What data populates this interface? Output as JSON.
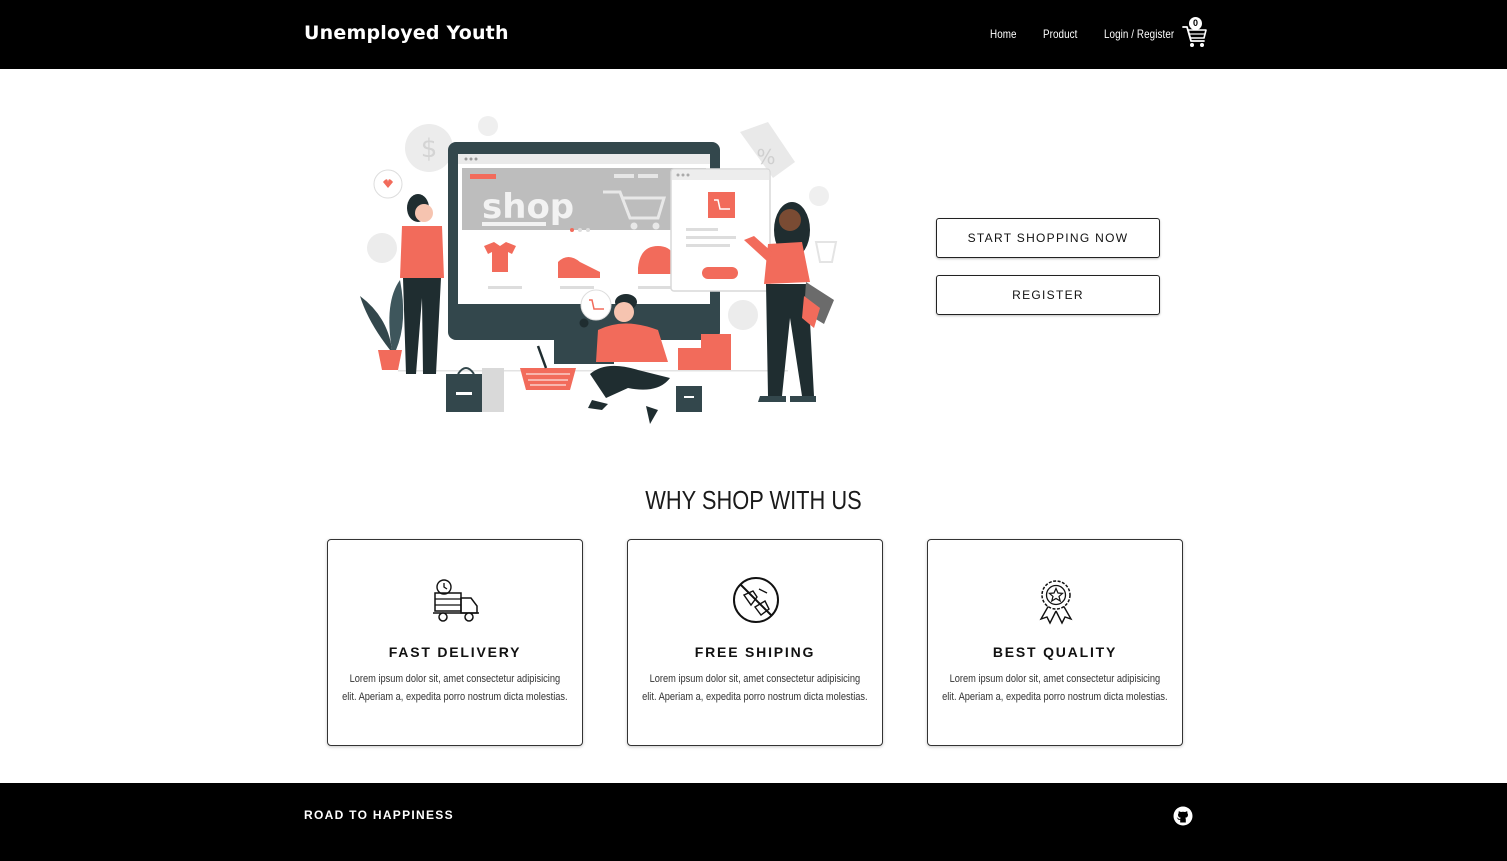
{
  "navbar": {
    "brand": "Unemployed Youth",
    "links": [
      "Home",
      "Product",
      "Login / Register"
    ],
    "cart_count": "0",
    "cart_icon": "shopping-cart-icon"
  },
  "hero": {
    "illustration_text": "shop",
    "start_shopping_label": "START SHOPPING NOW",
    "register_label": "REGISTER"
  },
  "features": {
    "title": "WHY SHOP WITH US",
    "cards": [
      {
        "icon": "delivery-truck-icon",
        "title": "FAST DELIVERY",
        "text": "Lorem ipsum dolor sit, amet consectetur adipisicing elit. Aperiam a, expedita porro nostrum dicta molestias."
      },
      {
        "icon": "no-fee-icon",
        "title": "FREE SHIPING",
        "text": "Lorem ipsum dolor sit, amet consectetur adipisicing elit. Aperiam a, expedita porro nostrum dicta molestias."
      },
      {
        "icon": "quality-badge-icon",
        "title": "BEST QUALITY",
        "text": "Lorem ipsum dolor sit, amet consectetur adipisicing elit. Aperiam a, expedita porro nostrum dicta molestias."
      }
    ]
  },
  "footer": {
    "tagline": "ROAD TO HAPPINESS",
    "icon": "github-icon"
  },
  "colors": {
    "accent": "#f26b5b",
    "dark": "#2f4a4f",
    "bar": "#000000"
  }
}
